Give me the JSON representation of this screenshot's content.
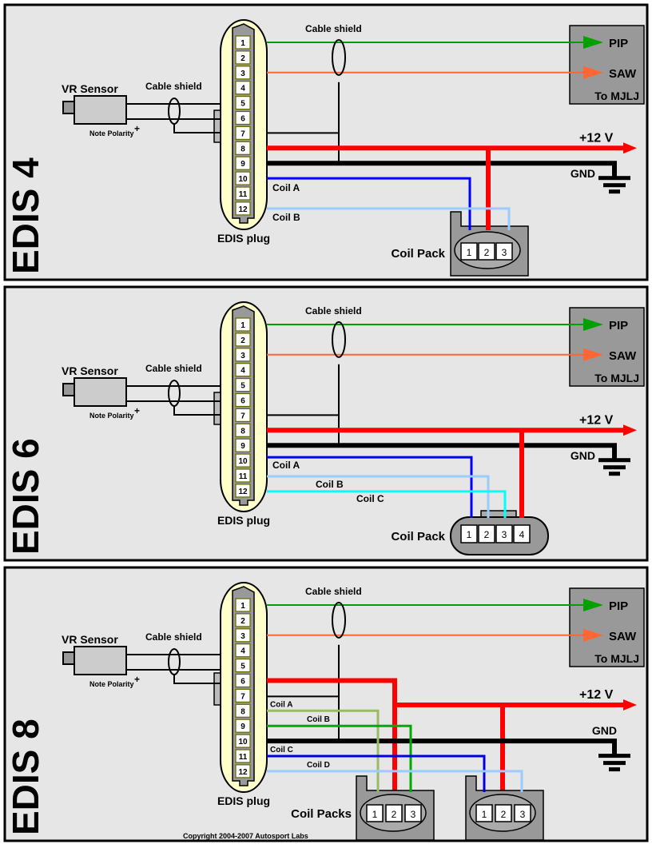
{
  "colors": {
    "panel_bg": "#e6e6e6",
    "border": "#000000",
    "pip_wire": "#00a000",
    "saw_wire": "#ff6633",
    "power_wire": "#ff0000",
    "ground_wire": "#000000",
    "plug_fill": "#ffffcc",
    "plug_body": "#999999",
    "pin_fill": "#ffffff",
    "pin_border": "#666600",
    "mjlj_box": "#999999",
    "coil_pack": "#999999",
    "coil_a_edis4": "#0000ff",
    "coil_b_edis4": "#99ccff",
    "coil_c_edis6": "#00ffff",
    "coil_a_edis8": "#99bb66",
    "coil_b_edis8": "#00aa00",
    "coil_c_edis8": "#0000dd",
    "coil_d_edis8": "#99ccff"
  },
  "panels": [
    {
      "title": "EDIS 4",
      "vr_sensor_label": "VR Sensor",
      "cable_shield_left": "Cable shield",
      "cable_shield_top": "Cable shield",
      "note_polarity": "Note Polarity",
      "polarity_mark": "+",
      "plug_label": "EDIS plug",
      "pins": [
        "1",
        "2",
        "3",
        "4",
        "5",
        "6",
        "7",
        "8",
        "9",
        "10",
        "11",
        "12"
      ],
      "mjlj": {
        "pip": "PIP",
        "saw": "SAW",
        "label": "To MJLJ"
      },
      "power_label": "+12 V",
      "ground_label": "GND",
      "coil_labels": [
        "Coil A",
        "Coil B"
      ],
      "coil_pack_label": "Coil Pack",
      "coil_pack_pins": [
        [
          "1",
          "2",
          "3"
        ]
      ]
    },
    {
      "title": "EDIS 6",
      "vr_sensor_label": "VR Sensor",
      "cable_shield_left": "Cable shield",
      "cable_shield_top": "Cable shield",
      "note_polarity": "Note Polarity",
      "polarity_mark": "+",
      "plug_label": "EDIS plug",
      "pins": [
        "1",
        "2",
        "3",
        "4",
        "5",
        "6",
        "7",
        "8",
        "9",
        "10",
        "11",
        "12"
      ],
      "mjlj": {
        "pip": "PIP",
        "saw": "SAW",
        "label": "To MJLJ"
      },
      "power_label": "+12 V",
      "ground_label": "GND",
      "coil_labels": [
        "Coil A",
        "Coil B",
        "Coil C"
      ],
      "coil_pack_label": "Coil Pack",
      "coil_pack_pins": [
        [
          "1",
          "2",
          "3",
          "4"
        ]
      ]
    },
    {
      "title": "EDIS 8",
      "vr_sensor_label": "VR Sensor",
      "cable_shield_left": "Cable shield",
      "cable_shield_top": "Cable shield",
      "note_polarity": "Note Polarity",
      "polarity_mark": "+",
      "plug_label": "EDIS plug",
      "pins": [
        "1",
        "2",
        "3",
        "4",
        "5",
        "6",
        "7",
        "8",
        "9",
        "10",
        "11",
        "12"
      ],
      "mjlj": {
        "pip": "PIP",
        "saw": "SAW",
        "label": "To MJLJ"
      },
      "power_label": "+12 V",
      "ground_label": "GND",
      "coil_labels": [
        "Coil A",
        "Coil B",
        "Coil C",
        "Coil D"
      ],
      "coil_pack_label": "Coil Packs",
      "coil_pack_pins": [
        [
          "1",
          "2",
          "3"
        ],
        [
          "1",
          "2",
          "3"
        ]
      ]
    }
  ],
  "copyright": "Copyright 2004-2007 Autosport Labs"
}
